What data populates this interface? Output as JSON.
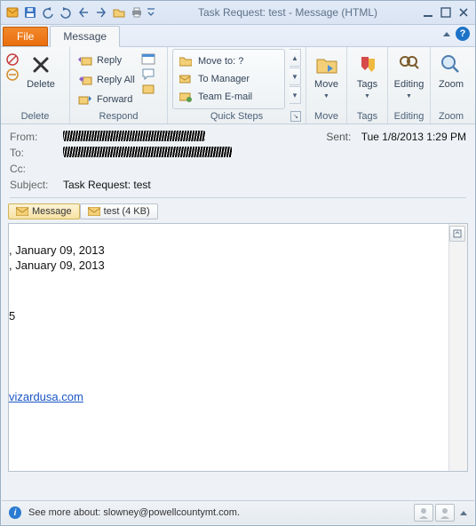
{
  "title": "Task Request: test - Message (HTML)",
  "tabs": {
    "file": "File",
    "message": "Message"
  },
  "ribbon": {
    "delete_group": {
      "label": "Delete",
      "delete_btn": "Delete"
    },
    "respond_group": {
      "label": "Respond",
      "reply": "Reply",
      "reply_all": "Reply All",
      "forward": "Forward"
    },
    "quicksteps_group": {
      "label": "Quick Steps",
      "items": [
        "Move to: ?",
        "To Manager",
        "Team E-mail"
      ]
    },
    "move_group": {
      "label": "Move",
      "btn": "Move"
    },
    "tags_group": {
      "label": "Tags",
      "btn": "Tags"
    },
    "editing_group": {
      "label": "Editing",
      "btn": "Editing"
    },
    "zoom_group": {
      "label": "Zoom",
      "btn": "Zoom"
    }
  },
  "headers": {
    "from_label": "From:",
    "to_label": "To:",
    "cc_label": "Cc:",
    "subject_label": "Subject:",
    "subject_value": "Task Request: test",
    "sent_label": "Sent:",
    "sent_value": "Tue 1/8/2013 1:29 PM"
  },
  "message_tabs": {
    "message": "Message",
    "attachment": "test (4 KB)"
  },
  "body": {
    "line1": ", January 09, 2013",
    "line2": ", January 09, 2013",
    "line3": "5",
    "link": "vizardusa.com"
  },
  "status": {
    "text": "See more about: slowney@powellcountymt.com."
  }
}
